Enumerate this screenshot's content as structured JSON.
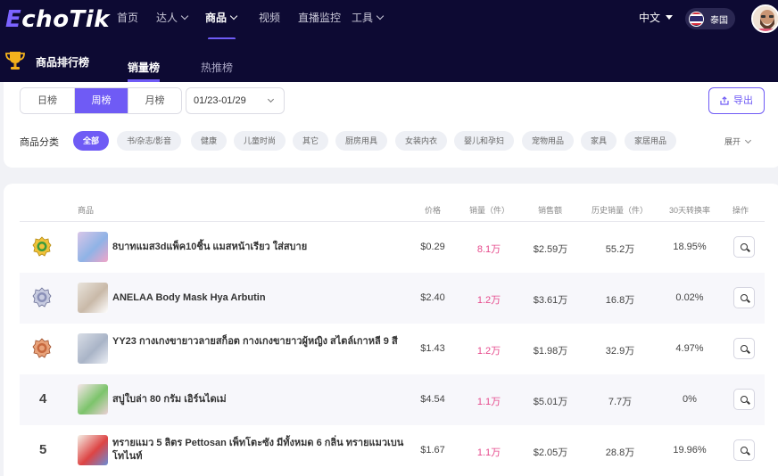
{
  "nav": {
    "logo_e": "E",
    "logo_rest": "choTik",
    "items": [
      {
        "label": "首页",
        "chevron": false
      },
      {
        "label": "达人",
        "chevron": true
      },
      {
        "label": "商品",
        "chevron": true,
        "active": true
      },
      {
        "label": "视频",
        "chevron": false
      },
      {
        "label": "直播监控",
        "chevron": false
      },
      {
        "label": "工具",
        "chevron": true
      }
    ],
    "language": "中文",
    "region": "泰国"
  },
  "subheader": {
    "title": "商品排行榜",
    "tabs": [
      {
        "label": "销量榜",
        "active": true
      },
      {
        "label": "热推榜",
        "active": false
      }
    ]
  },
  "filters": {
    "period_tabs": [
      {
        "label": "日榜",
        "active": false
      },
      {
        "label": "周榜",
        "active": true
      },
      {
        "label": "月榜",
        "active": false
      }
    ],
    "date_range": "01/23-01/29",
    "export_label": "导出",
    "category_label": "商品分类",
    "categories": [
      {
        "label": "全部",
        "active": true
      },
      {
        "label": "书/杂志/影音"
      },
      {
        "label": "健康"
      },
      {
        "label": "儿童时尚"
      },
      {
        "label": "其它"
      },
      {
        "label": "厨房用具"
      },
      {
        "label": "女装内衣"
      },
      {
        "label": "婴儿和孕妇"
      },
      {
        "label": "宠物用品"
      },
      {
        "label": "家具"
      },
      {
        "label": "家居用品"
      }
    ],
    "expand_label": "展开"
  },
  "table": {
    "headers": {
      "product": "商品",
      "price": "价格",
      "sales": "销量（件）",
      "revenue": "销售额",
      "history_sales": "历史销量（件）",
      "conversion": "30天转换率",
      "action": "操作"
    },
    "rows": [
      {
        "rank": "1",
        "medal": "gold",
        "name": "8บาทแมส3dแพ็ค10ชิ้น แมสหน้าเรียว ใส่สบาย",
        "price": "$0.29",
        "sales": "8.1万",
        "revenue": "$2.59万",
        "history": "55.2万",
        "conversion": "18.95%"
      },
      {
        "rank": "2",
        "medal": "silver",
        "name": "ANELAA Body Mask Hya Arbutin",
        "price": "$2.40",
        "sales": "1.2万",
        "revenue": "$3.61万",
        "history": "16.8万",
        "conversion": "0.02%"
      },
      {
        "rank": "3",
        "medal": "bronze",
        "name": "YY23 กางเกงขายาวลายสก็อต กางเกงขายาวผู้หญิง สไตล์เกาหลี 9 สี",
        "price": "$1.43",
        "sales": "1.2万",
        "revenue": "$1.98万",
        "history": "32.9万",
        "conversion": "4.97%"
      },
      {
        "rank": "4",
        "medal": "",
        "name": "สบู่ใบล่า 80 กรัม เอิร์นไดเม่",
        "price": "$4.54",
        "sales": "1.1万",
        "revenue": "$5.01万",
        "history": "7.7万",
        "conversion": "0%"
      },
      {
        "rank": "5",
        "medal": "",
        "name": "ทรายแมว 5 ลิตร Pettosan เพ็ทโตะซัง มีทั้งหมด 6 กลิ่น ทรายแมวเบนโทไนท์",
        "price": "$1.67",
        "sales": "1.1万",
        "revenue": "$2.05万",
        "history": "28.8万",
        "conversion": "19.96%"
      }
    ]
  },
  "colors": {
    "nav_bg": "#0d0a33",
    "accent": "#6f5bf5",
    "sales_pink": "#e64a8c"
  }
}
